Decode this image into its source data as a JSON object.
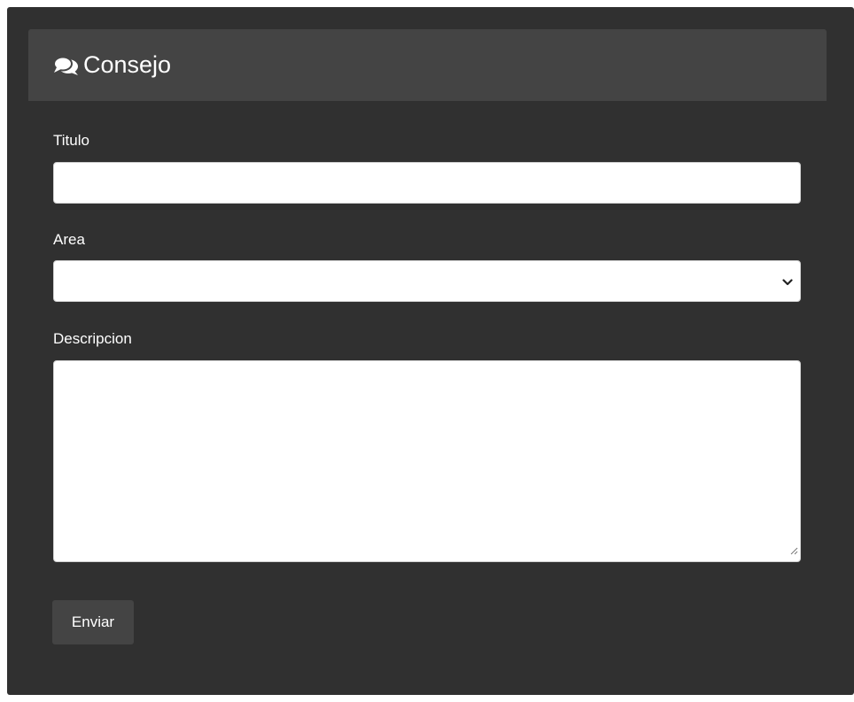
{
  "card": {
    "icon": "comments-icon",
    "title": "Consejo"
  },
  "form": {
    "titulo": {
      "label": "Titulo",
      "value": "",
      "placeholder": ""
    },
    "area": {
      "label": "Area",
      "selected": "",
      "icon": "chevron-down-icon"
    },
    "descripcion": {
      "label": "Descripcion",
      "value": "",
      "resize_icon": "resize-grip-icon"
    },
    "submit_label": "Enviar"
  },
  "colors": {
    "panel_background": "#303030",
    "header_background": "#444444",
    "button_background": "#444444",
    "text": "#ffffff",
    "input_background": "#ffffff"
  }
}
